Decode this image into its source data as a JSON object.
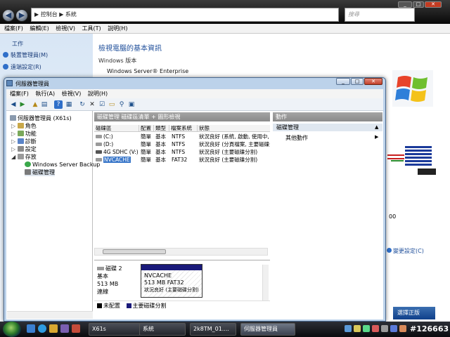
{
  "background_window": {
    "breadcrumb": "▶ 控制台 ▶ 系統",
    "search_placeholder": "搜尋",
    "menu": [
      "檔案(F)",
      "編輯(E)",
      "檢視(V)",
      "工具(T)",
      "說明(H)"
    ],
    "task_header": "工作",
    "tasks": [
      "裝置管理員(M)",
      "遠端設定(R)"
    ],
    "page_title": "檢視電腦的基本資訊",
    "edition_label": "Windows 版本",
    "edition_name": "Windows Server® Enterprise",
    "partial_number": "00",
    "change_settings": "變更設定(C)",
    "blue_button": "選擇正版"
  },
  "server_manager": {
    "title": "伺服器管理員",
    "menu": [
      "檔案(F)",
      "執行(A)",
      "檢視(V)",
      "說明(H)"
    ],
    "tree": {
      "root": "伺服器管理員 (X61s)",
      "items": [
        "角色",
        "功能",
        "診斷",
        "設定",
        "存放"
      ],
      "storage_children": [
        "Windows Server Backup",
        "磁碟管理"
      ]
    },
    "center_header": "磁碟管理  磁碟區清單 + 圖形檢視",
    "columns": [
      "磁碟區",
      "配置",
      "類型",
      "檔案系統",
      "狀態"
    ],
    "volumes": [
      {
        "name": "(C:)",
        "layout": "簡單",
        "type": "基本",
        "fs": "NTFS",
        "status": "狀況良好 (系統, 啟動, 使用中, 損"
      },
      {
        "name": "(D:)",
        "layout": "簡單",
        "type": "基本",
        "fs": "NTFS",
        "status": "狀況良好 (分頁檔案, 主要磁碟分"
      },
      {
        "name": "4G SDHC (V:)",
        "layout": "簡單",
        "type": "基本",
        "fs": "NTFS",
        "status": "狀況良好 (主要磁碟分割)"
      },
      {
        "name": "NVCACHE",
        "layout": "簡單",
        "type": "基本",
        "fs": "FAT32",
        "status": "狀況良好 (主要磁碟分割)"
      }
    ],
    "disk": {
      "name": "磁碟 2",
      "type": "基本",
      "size": "513 MB",
      "state": "連線"
    },
    "partition": {
      "name": "NVCACHE",
      "size_fs": "513 MB FAT32",
      "status": "狀況良好 (主要磁碟分割)"
    },
    "legend": [
      {
        "label": "未配置",
        "color": "#000000"
      },
      {
        "label": "主要磁碟分割",
        "color": "#1a1a7a"
      }
    ],
    "actions": {
      "header": "動作",
      "section": "磁碟管理",
      "more": "其他動作"
    }
  },
  "taskbar": {
    "buttons": [
      "X61s",
      "系統",
      "2k8TM_01....",
      "伺服器管理員"
    ],
    "watermark": "#126663"
  }
}
